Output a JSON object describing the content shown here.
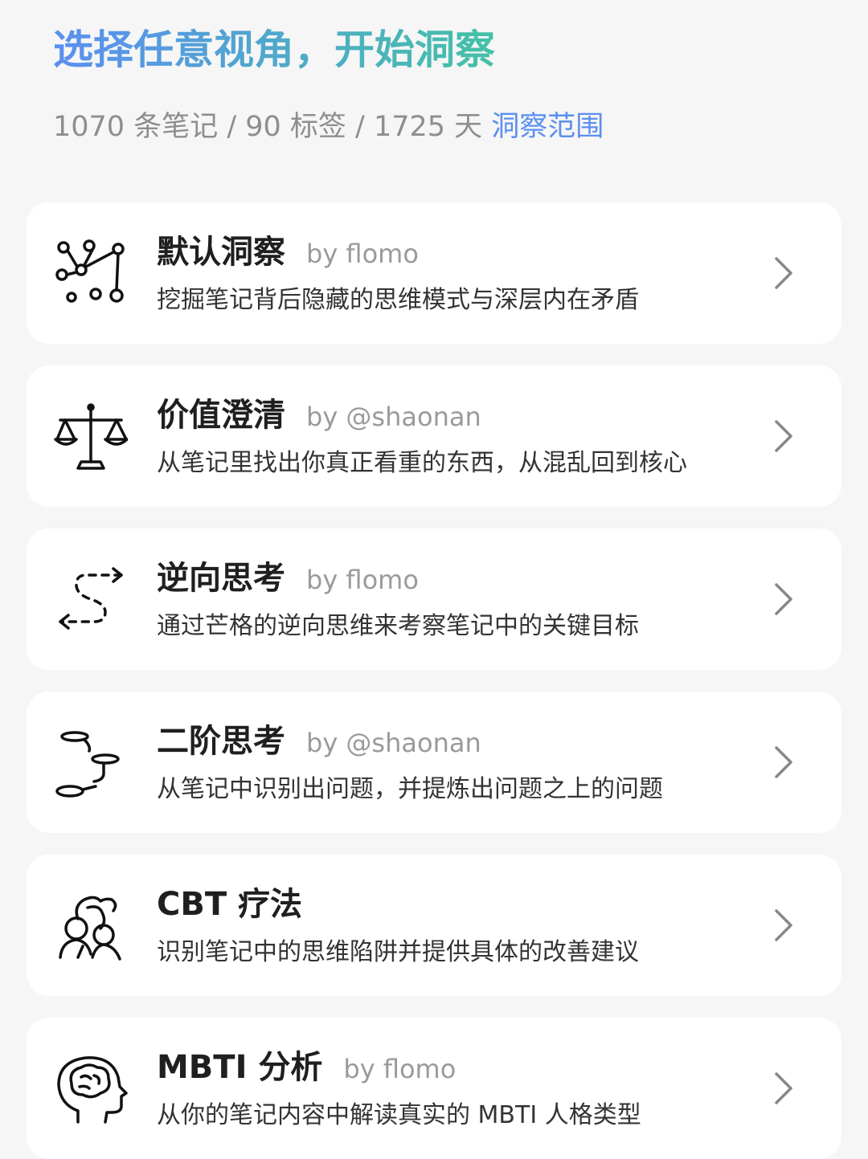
{
  "header": {
    "title": "选择任意视角，开始洞察",
    "stats_text": "1070 条笔记 / 90 标签 / 1725 天",
    "scope_link": "洞察范围"
  },
  "cards": [
    {
      "title": "默认洞察",
      "author": "by flomo",
      "description": "挖掘笔记背后隐藏的思维模式与深层内在矛盾",
      "icon": "network-nodes-icon"
    },
    {
      "title": "价值澄清",
      "author": "by @shaonan",
      "description": "从笔记里找出你真正看重的东西，从混乱回到核心",
      "icon": "balance-scale-icon"
    },
    {
      "title": "逆向思考",
      "author": "by flomo",
      "description": "通过芒格的逆向思维来考察笔记中的关键目标",
      "icon": "reverse-path-arrows-icon"
    },
    {
      "title": "二阶思考",
      "author": "by @shaonan",
      "description": "从笔记中识别出问题，并提炼出问题之上的问题",
      "icon": "stepping-stones-icon"
    },
    {
      "title": "CBT 疗法",
      "author": "",
      "description": "识别笔记中的思维陷阱并提供具体的改善建议",
      "icon": "therapy-people-icon"
    },
    {
      "title": "MBTI 分析",
      "author": "by flomo",
      "description": "从你的笔记内容中解读真实的 MBTI 人格类型",
      "icon": "head-brain-icon"
    }
  ],
  "colors": {
    "accent_blue": "#5b8ff0",
    "accent_green": "#45c1a6",
    "background": "#f6f6f6",
    "card": "#ffffff",
    "muted_text": "#9a9a9a"
  },
  "chevron_icon": "chevron-right-icon"
}
